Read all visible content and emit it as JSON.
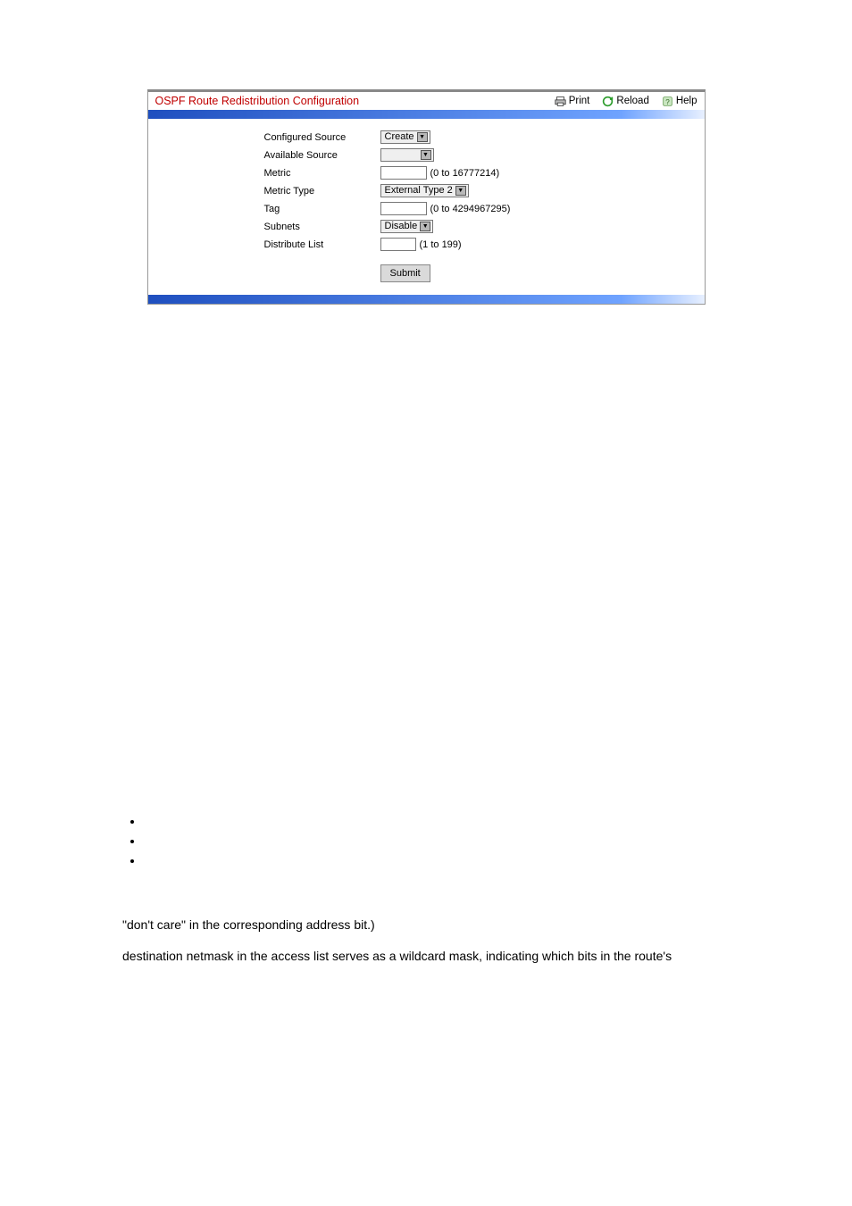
{
  "panel": {
    "title": "OSPF Route Redistribution Configuration",
    "links": {
      "print": "Print",
      "reload": "Reload",
      "help": "Help"
    }
  },
  "form": {
    "rows": {
      "configured_source": {
        "label": "Configured Source",
        "select_value": "Create"
      },
      "available_source": {
        "label": "Available Source",
        "select_value": ""
      },
      "metric": {
        "label": "Metric",
        "hint": "(0 to 16777214)"
      },
      "metric_type": {
        "label": "Metric Type",
        "select_value": "External Type 2"
      },
      "tag": {
        "label": "Tag",
        "hint": "(0 to 4294967295)"
      },
      "subnets": {
        "label": "Subnets",
        "select_value": "Disable"
      },
      "distribute_list": {
        "label": "Distribute List",
        "hint": "(1 to 199)"
      }
    },
    "submit_label": "Submit"
  },
  "body": {
    "line1": "\"don't care\" in the corresponding address bit.)",
    "line2": "destination netmask in the access list serves as a wildcard mask, indicating which bits in the route's"
  }
}
